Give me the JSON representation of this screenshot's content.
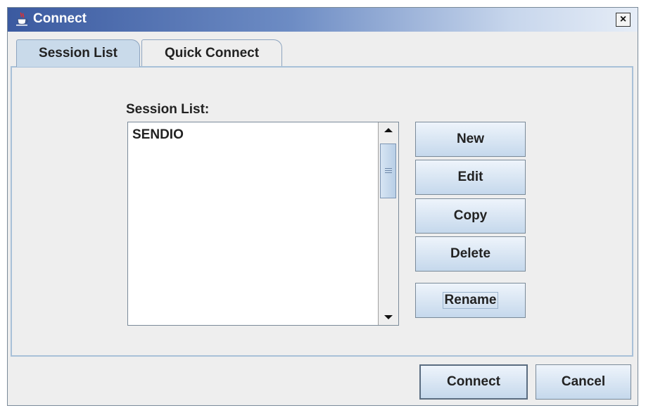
{
  "window": {
    "title": "Connect",
    "close_label": "×"
  },
  "tabs": [
    {
      "label": "Session List",
      "active": true
    },
    {
      "label": "Quick Connect",
      "active": false
    }
  ],
  "session_panel": {
    "label": "Session List:",
    "items": [
      "SENDIO"
    ]
  },
  "side_buttons": {
    "new": "New",
    "edit": "Edit",
    "copy": "Copy",
    "delete": "Delete",
    "rename": "Rename"
  },
  "footer": {
    "connect": "Connect",
    "cancel": "Cancel"
  },
  "icons": {
    "title": "java-cup-icon",
    "close": "close-icon",
    "scroll_up": "arrow-up-icon",
    "scroll_down": "arrow-down-icon"
  },
  "colors": {
    "titlebar_start": "#3b5aa0",
    "titlebar_end": "#e6edf7",
    "active_tab": "#c9daea",
    "panel_border": "#a8c0d8",
    "button_gradient_top": "#eef4fb",
    "button_gradient_bottom": "#c5d8ec"
  }
}
